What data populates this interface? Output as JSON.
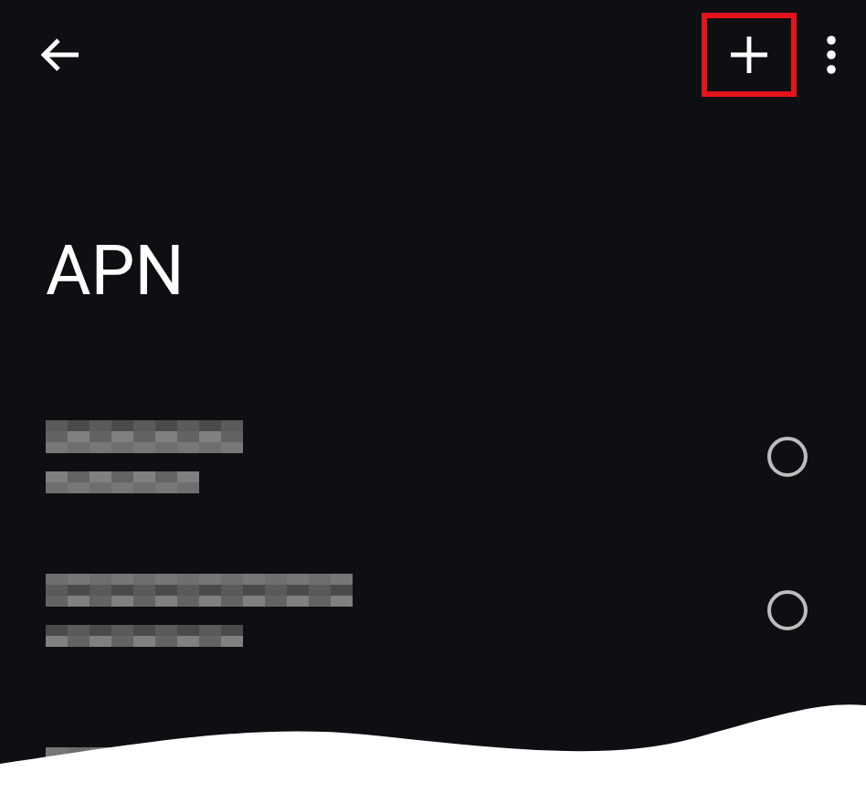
{
  "title": "APN",
  "add_button": {
    "highlighted": true
  },
  "apns": [
    {
      "selected": false
    },
    {
      "selected": false
    }
  ]
}
